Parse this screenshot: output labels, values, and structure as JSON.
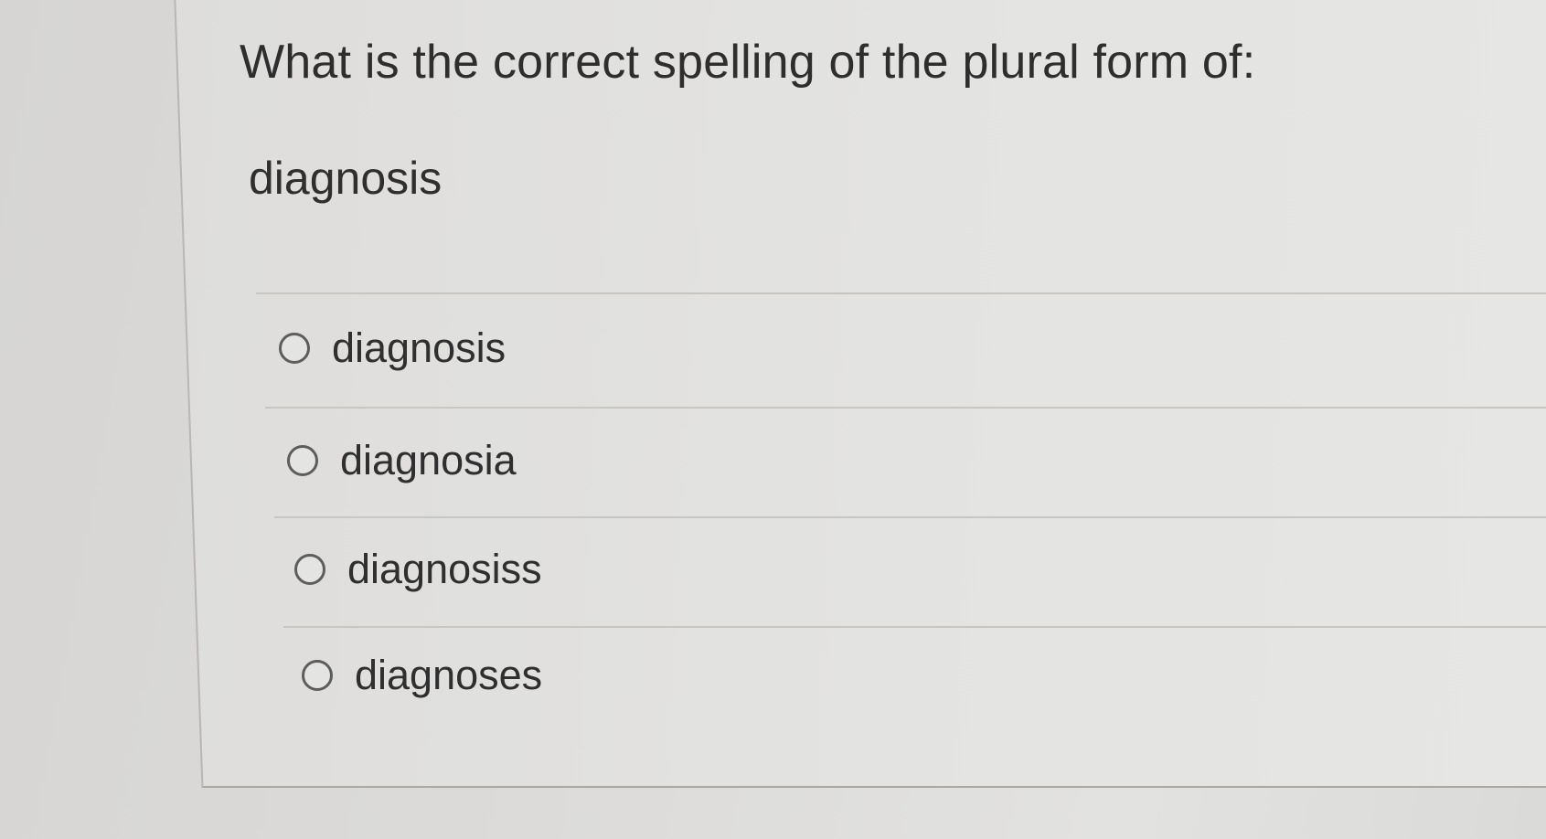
{
  "question": {
    "prompt": "What is the correct spelling of the plural form of:",
    "term": "diagnosis"
  },
  "options": [
    {
      "label": "diagnosis",
      "selected": false
    },
    {
      "label": "diagnosia",
      "selected": false
    },
    {
      "label": "diagnosiss",
      "selected": false
    },
    {
      "label": "diagnoses",
      "selected": false
    }
  ]
}
